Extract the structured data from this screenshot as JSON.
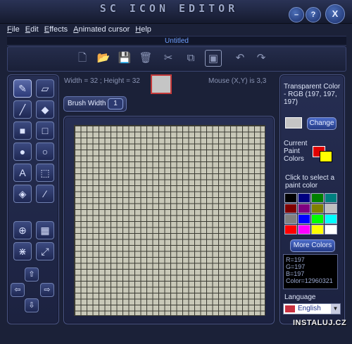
{
  "window": {
    "title": "SC ICON EDITOR",
    "minimize": "–",
    "help": "?",
    "close": "X"
  },
  "menu": [
    "File",
    "Edit",
    "Effects",
    "Animated cursor",
    "Help"
  ],
  "document": {
    "name": "Untitled"
  },
  "info": {
    "size": "Width = 32 ; Height = 32",
    "mouse": "Mouse (X,Y) is 3,3"
  },
  "brush": {
    "label": "Brush Width",
    "value": "1"
  },
  "right_panel": {
    "transparent_label": "Transparent Color - RGB (197, 197, 197)",
    "transparent_color": "#c5c5c5",
    "change_btn": "Change",
    "current_label": "Current Paint Colors",
    "primary_color": "#e00000",
    "secondary_color": "#ffff00",
    "select_label": "Click to select a paint color",
    "palette": [
      "#000000",
      "#000080",
      "#008000",
      "#008080",
      "#800000",
      "#800080",
      "#808000",
      "#c0c0c0",
      "#808080",
      "#0000ff",
      "#00ff00",
      "#00ffff",
      "#ff0000",
      "#ff00ff",
      "#ffff00",
      "#ffffff"
    ],
    "more_btn": "More Colors",
    "rgb_lines": [
      "R=197",
      "G=197",
      "B=197",
      "Color=12960321"
    ],
    "language_label": "Language",
    "language_value": "English"
  },
  "watermark": "INSTALUJ.CZ"
}
